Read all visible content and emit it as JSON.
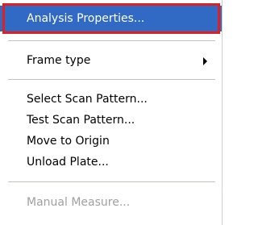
{
  "menu": {
    "items": [
      {
        "label": "Analysis Properties..."
      },
      {
        "label": "Frame type"
      },
      {
        "label": "Select Scan Pattern..."
      },
      {
        "label": "Test Scan Pattern..."
      },
      {
        "label": "Move to Origin"
      },
      {
        "label": "Unload Plate..."
      },
      {
        "label": "Manual Measure..."
      }
    ],
    "submenu_arrow_icon": "triangle-right",
    "colors": {
      "highlight": "#316ac5",
      "highlight_frame": "#e0201f",
      "disabled_text": "#a0a0a0"
    }
  }
}
